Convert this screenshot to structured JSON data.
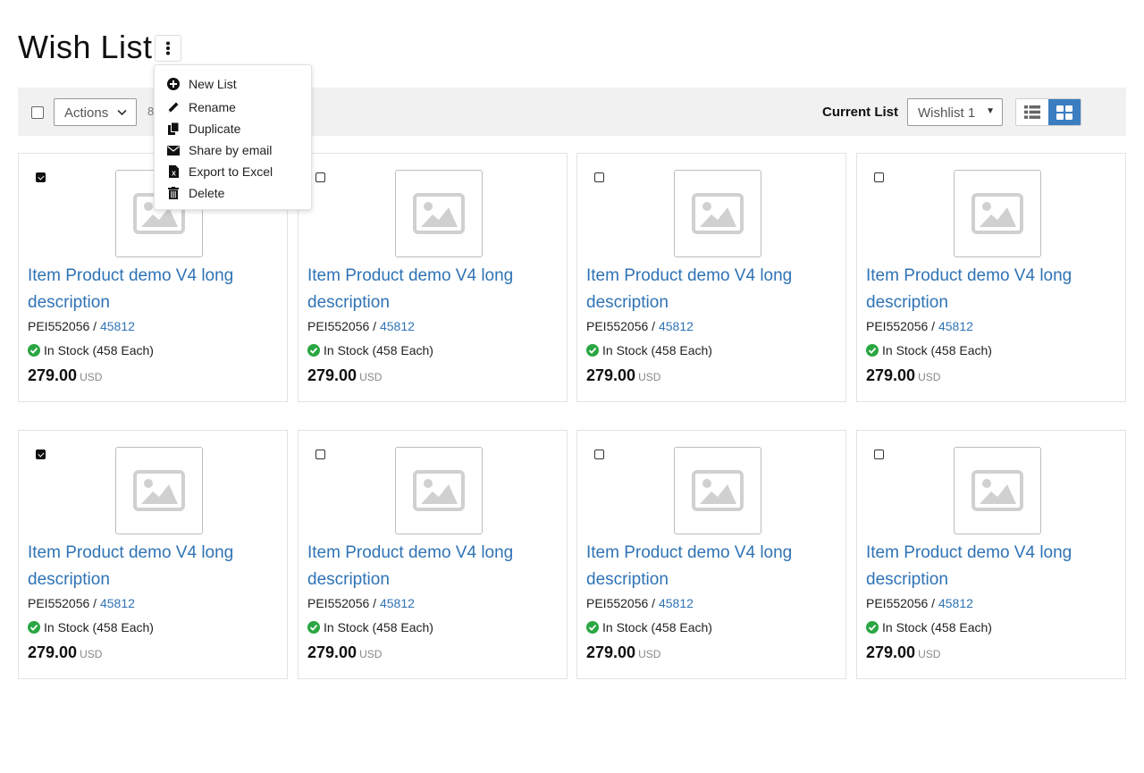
{
  "page": {
    "title": "Wish List"
  },
  "menu": {
    "items": [
      {
        "label": "New List",
        "icon": "plus-circle-icon"
      },
      {
        "label": "Rename",
        "icon": "pencil-icon"
      },
      {
        "label": "Duplicate",
        "icon": "copy-icon"
      },
      {
        "label": "Share by email",
        "icon": "envelope-icon"
      },
      {
        "label": "Export to Excel",
        "icon": "excel-file-icon"
      },
      {
        "label": "Delete",
        "icon": "trash-icon"
      }
    ]
  },
  "toolbar": {
    "actions_label": "Actions",
    "count_text": "8",
    "current_list_label": "Current List",
    "current_list_value": "Wishlist 1",
    "view_modes": [
      "list",
      "grid"
    ],
    "active_view": "grid"
  },
  "colors": {
    "link": "#2f73b5",
    "accent": "#3a7dc1",
    "toolbar_bg": "#f1f1f1",
    "in_stock": "#2aa642"
  },
  "products": [
    {
      "checked": true,
      "title": "Item Product demo V4 long description",
      "sku": "PEI552056",
      "sku_link": "45812",
      "stock": "In Stock (458 Each)",
      "price": "279.00",
      "currency": "USD"
    },
    {
      "checked": false,
      "title": "Item Product demo V4 long description",
      "sku": "PEI552056",
      "sku_link": "45812",
      "stock": "In Stock (458 Each)",
      "price": "279.00",
      "currency": "USD"
    },
    {
      "checked": false,
      "title": "Item Product demo V4 long description",
      "sku": "PEI552056",
      "sku_link": "45812",
      "stock": "In Stock (458 Each)",
      "price": "279.00",
      "currency": "USD"
    },
    {
      "checked": false,
      "title": "Item Product demo V4 long description",
      "sku": "PEI552056",
      "sku_link": "45812",
      "stock": "In Stock (458 Each)",
      "price": "279.00",
      "currency": "USD"
    },
    {
      "checked": true,
      "title": "Item Product demo V4 long description",
      "sku": "PEI552056",
      "sku_link": "45812",
      "stock": "In Stock (458 Each)",
      "price": "279.00",
      "currency": "USD"
    },
    {
      "checked": false,
      "title": "Item Product demo V4 long description",
      "sku": "PEI552056",
      "sku_link": "45812",
      "stock": "In Stock (458 Each)",
      "price": "279.00",
      "currency": "USD"
    },
    {
      "checked": false,
      "title": "Item Product demo V4 long description",
      "sku": "PEI552056",
      "sku_link": "45812",
      "stock": "In Stock (458 Each)",
      "price": "279.00",
      "currency": "USD"
    },
    {
      "checked": false,
      "title": "Item Product demo V4 long description",
      "sku": "PEI552056",
      "sku_link": "45812",
      "stock": "In Stock (458 Each)",
      "price": "279.00",
      "currency": "USD"
    }
  ]
}
